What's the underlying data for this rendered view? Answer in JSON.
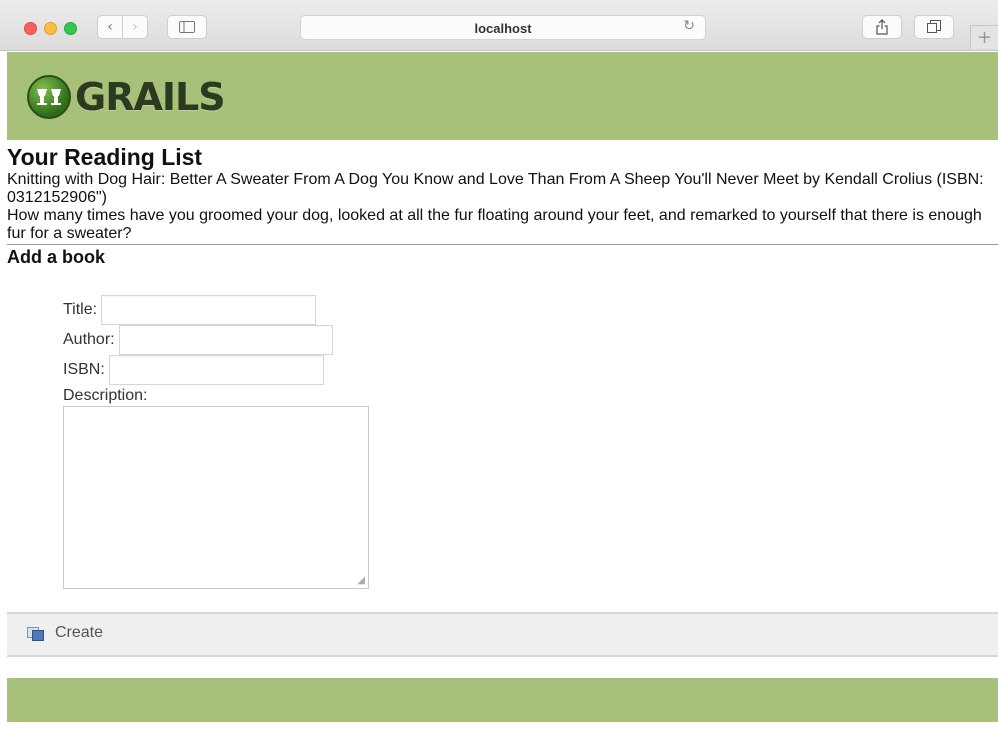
{
  "browser": {
    "url": "localhost",
    "back_glyph": "‹",
    "forward_glyph": "›",
    "reload_glyph": "↻",
    "newtab_glyph": "+"
  },
  "header": {
    "logo_text": "GRAILS",
    "background": "#a8c17a"
  },
  "reading_list": {
    "title": "Your Reading List",
    "books": [
      {
        "line": "Knitting with Dog Hair: Better A Sweater From A Dog You Know and Love Than From A Sheep You'll Never Meet by Kendall Crolius (ISBN: 0312152906\")",
        "description": "How many times have you groomed your dog, looked at all the fur floating around your feet, and remarked to yourself that there is enough fur for a sweater?"
      }
    ]
  },
  "add_book": {
    "title": "Add a book",
    "fields": {
      "title_label": "Title:",
      "title_value": "",
      "author_label": "Author:",
      "author_value": "",
      "isbn_label": "ISBN:",
      "isbn_value": "",
      "description_label": "Description:",
      "description_value": ""
    },
    "create_label": "Create"
  }
}
